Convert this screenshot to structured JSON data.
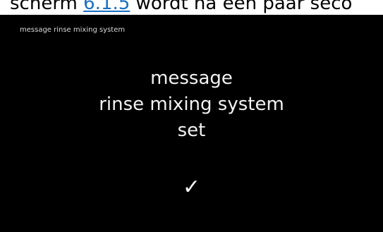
{
  "document": {
    "text_before": "scherm ",
    "link": "6.1.5",
    "text_after": " wordt na een paar seco"
  },
  "screen": {
    "title": "message rinse mixing system",
    "message_lines": [
      "message",
      "rinse mixing system",
      "set"
    ],
    "confirm_glyph": "✓"
  }
}
